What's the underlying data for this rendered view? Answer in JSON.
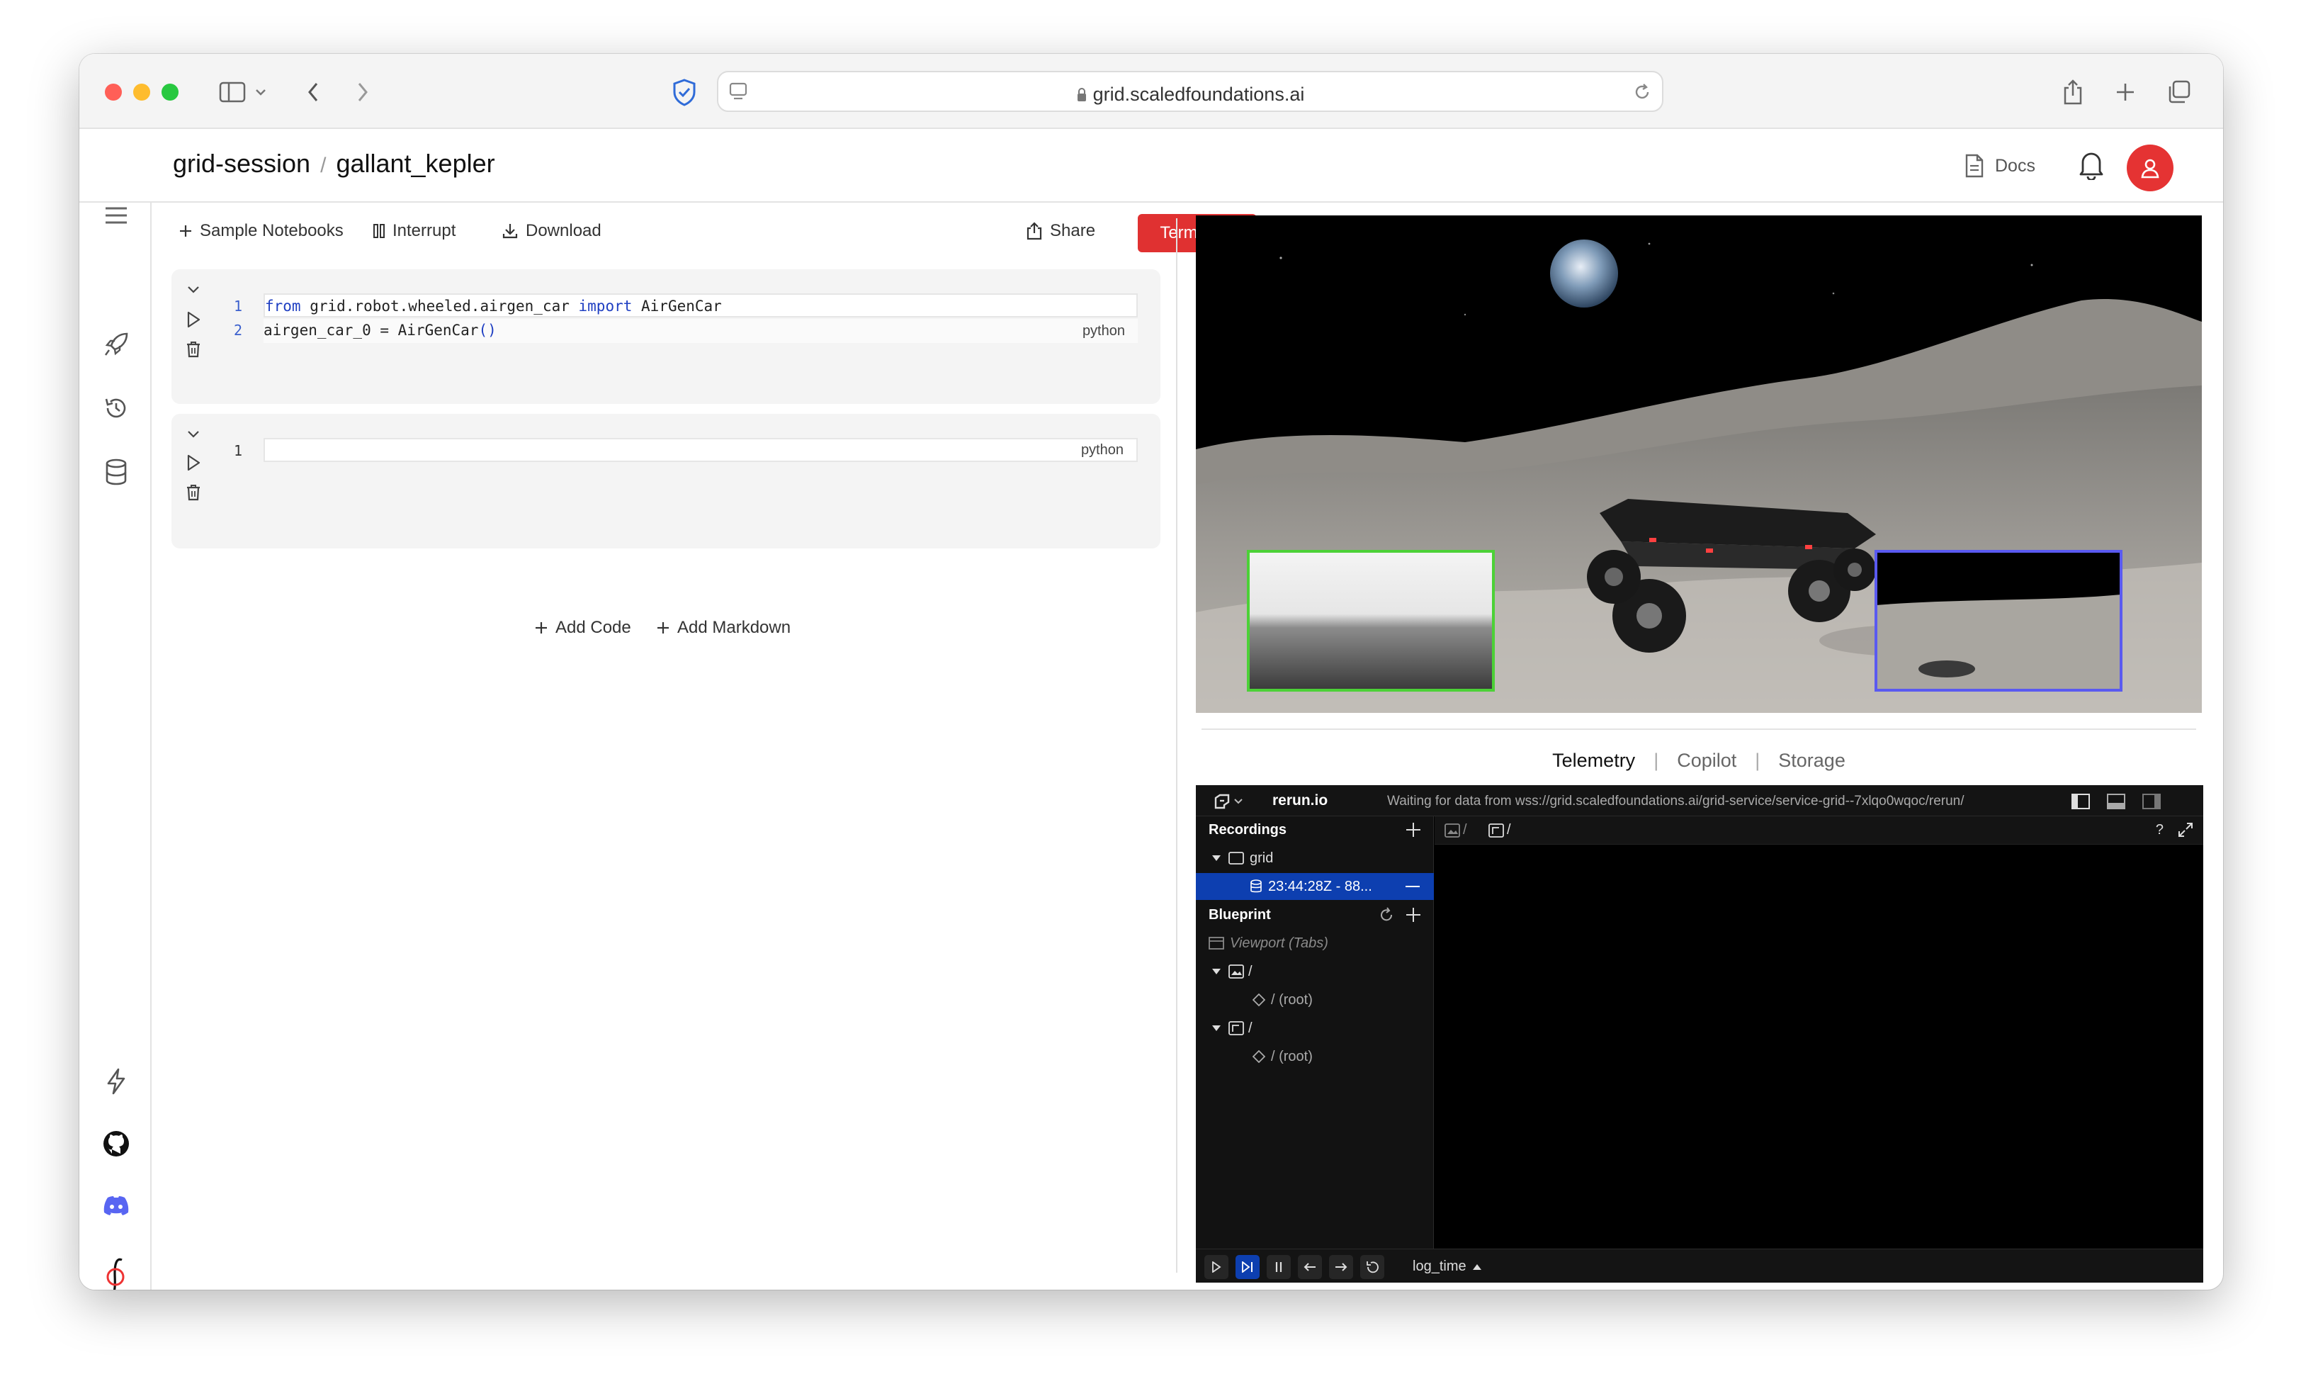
{
  "browser": {
    "url": "grid.scaledfoundations.ai"
  },
  "header": {
    "breadcrumb_root": "grid-session",
    "breadcrumb_sep": "/",
    "breadcrumb_session": "gallant_kepler",
    "docs_label": "Docs"
  },
  "toolbar": {
    "sample_notebooks": "Sample Notebooks",
    "interrupt": "Interrupt",
    "download": "Download",
    "share": "Share",
    "terminate": "Terminate"
  },
  "cells": [
    {
      "language": "python",
      "lines": [
        {
          "n": "1",
          "kw1": "from",
          "a": " grid.robot.wheeled.airgen_car ",
          "kw2": "import",
          "b": " AirGenCar"
        },
        {
          "n": "2",
          "text": "airgen_car_0 = AirGenCar",
          "paren": "()"
        }
      ]
    },
    {
      "language": "python",
      "lines": [
        {
          "n": "1"
        }
      ]
    }
  ],
  "add": {
    "code": "Add Code",
    "markdown": "Add Markdown"
  },
  "panel_tabs": {
    "telemetry": "Telemetry",
    "copilot": "Copilot",
    "storage": "Storage",
    "sep": "|"
  },
  "rerun": {
    "brand": "rerun.io",
    "status": "Waiting for data from wss://grid.scaledfoundations.ai/grid-service/service-grid--7xlqo0wqoc/rerun/",
    "recordings_label": "Recordings",
    "recording_app": "grid",
    "recording_item": "23:44:28Z - 88...",
    "blueprint_label": "Blueprint",
    "viewport": "Viewport (Tabs)",
    "slash": "/",
    "root": "/ (root)",
    "timeline": "log_time",
    "help": "?"
  },
  "colors": {
    "terminate": "#e03131",
    "avatar": "#e53333",
    "rerun_selected": "#0d3fb0",
    "inset_green": "#4cd137",
    "inset_blue": "#5a5af0"
  }
}
